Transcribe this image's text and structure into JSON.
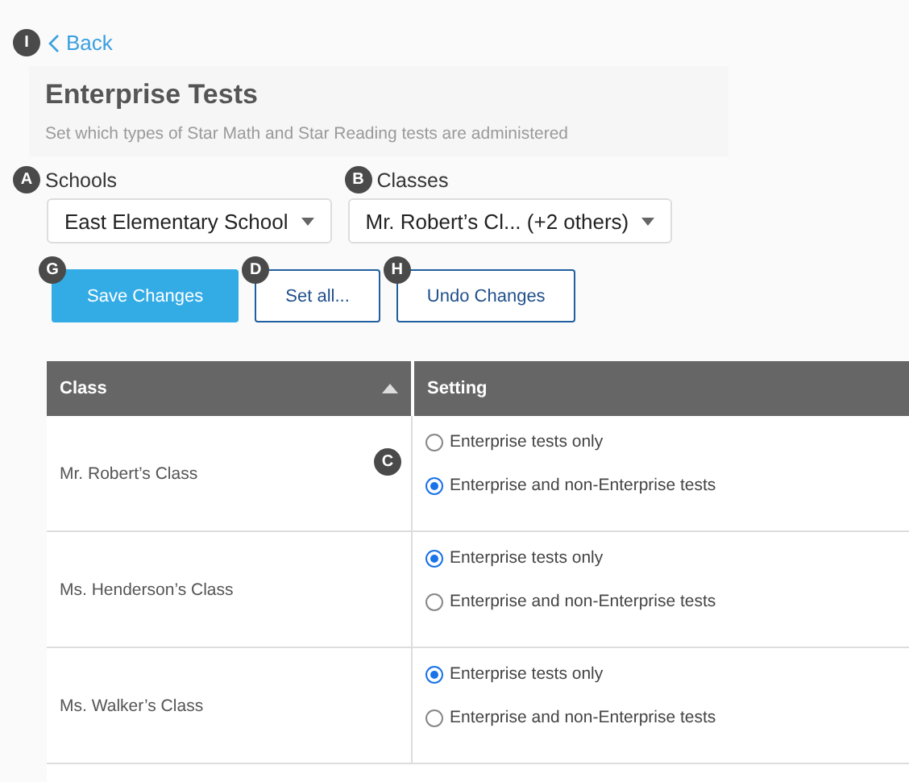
{
  "back": {
    "label": "Back",
    "callout": "I"
  },
  "header": {
    "title": "Enterprise Tests",
    "subtitle": "Set which types of Star Math and Star Reading tests are administered"
  },
  "filters": [
    {
      "label": "Schools",
      "callout": "A",
      "value": "East Elementary School"
    },
    {
      "label": "Classes",
      "callout": "B",
      "value": "Mr. Robert’s Cl... (+2 others)"
    }
  ],
  "buttons": [
    {
      "label": "Save Changes",
      "kind": "primary",
      "callout": "G"
    },
    {
      "label": "Set all...",
      "kind": "outline",
      "callout": "D"
    },
    {
      "label": "Undo Changes",
      "kind": "outline",
      "callout": "H"
    }
  ],
  "table": {
    "columns": [
      {
        "label": "Class",
        "sorted": true
      },
      {
        "label": "Setting",
        "sorted": false
      }
    ],
    "rows": [
      {
        "class": "Mr. Robert’s Class",
        "callout": "C",
        "options": [
          {
            "label": "Enterprise tests only",
            "selected": false
          },
          {
            "label": "Enterprise and non-Enterprise tests",
            "selected": true
          }
        ]
      },
      {
        "class": "Ms. Henderson’s Class",
        "options": [
          {
            "label": "Enterprise tests only",
            "selected": true
          },
          {
            "label": "Enterprise and non-Enterprise tests",
            "selected": false
          }
        ]
      },
      {
        "class": "Ms. Walker’s Class",
        "options": [
          {
            "label": "Enterprise tests only",
            "selected": true
          },
          {
            "label": "Enterprise and non-Enterprise tests",
            "selected": false
          }
        ]
      }
    ]
  }
}
